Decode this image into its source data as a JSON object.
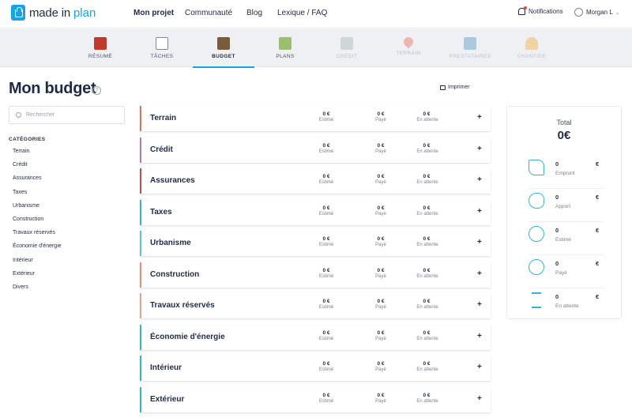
{
  "brand": {
    "part1": "made in",
    "part2": "plan"
  },
  "topnav": [
    {
      "label": "Mon projet",
      "active": true
    },
    {
      "label": "Communauté"
    },
    {
      "label": "Blog"
    },
    {
      "label": "Lexique / FAQ"
    }
  ],
  "header_right": {
    "notifications": "Notifications",
    "user": "Morgan L"
  },
  "tabs": [
    {
      "label": "RÉSUMÉ",
      "icon": "house-icon",
      "color": "#c0392b"
    },
    {
      "label": "TÂCHES",
      "icon": "checklist-icon",
      "color": "#7f8c8d"
    },
    {
      "label": "BUDGET",
      "icon": "calculator-icon",
      "color": "#7a5c3a",
      "active": true
    },
    {
      "label": "PLANS",
      "icon": "map-icon",
      "color": "#27ae60"
    },
    {
      "label": "CRÉDIT",
      "icon": "bank-icon",
      "color": "#7f8c8d",
      "disabled": true
    },
    {
      "label": "TERRAIN",
      "icon": "location-pin-icon",
      "color": "#e74c3c",
      "disabled": true
    },
    {
      "label": "PRESTATAIRES",
      "icon": "id-card-icon",
      "color": "#2980b9",
      "disabled": true
    },
    {
      "label": "CHANTIER",
      "icon": "hard-hat-icon",
      "color": "#f39c12",
      "disabled": true
    }
  ],
  "page_title": "Mon budget",
  "help_icon": "?",
  "print_label": "Imprimer",
  "search": {
    "placeholder": "Rechercher",
    "value": ""
  },
  "categories_title": "CATÉGORIES",
  "categories": [
    "Terrain",
    "Crédit",
    "Assurances",
    "Taxes",
    "Urbanisme",
    "Construction",
    "Travaux réservés",
    "Économie d'énergie",
    "Intérieur",
    "Extérieur",
    "Divers"
  ],
  "value_labels": {
    "estime": "Estimé",
    "paye": "Payé",
    "attente": "En attente"
  },
  "budget_rows": [
    {
      "name": "Terrain",
      "estime": "0 €",
      "paye": "0 €",
      "attente": "0 €",
      "color": "#c97b5a"
    },
    {
      "name": "Crédit",
      "estime": "0 €",
      "paye": "0 €",
      "attente": "0 €",
      "color": "#b07cc6"
    },
    {
      "name": "Assurances",
      "estime": "0 €",
      "paye": "0 €",
      "attente": "0 €",
      "color": "#c0504d"
    },
    {
      "name": "Taxes",
      "estime": "0 €",
      "paye": "0 €",
      "attente": "0 €",
      "color": "#3ab0d6"
    },
    {
      "name": "Urbanisme",
      "estime": "0 €",
      "paye": "0 €",
      "attente": "0 €",
      "color": "#5fc7c7"
    },
    {
      "name": "Construction",
      "estime": "0 €",
      "paye": "0 €",
      "attente": "0 €",
      "color": "#d9956b"
    },
    {
      "name": "Travaux réservés",
      "estime": "0 €",
      "paye": "0 €",
      "attente": "0 €",
      "color": "#e0a48a"
    },
    {
      "name": "Économie d'énergie",
      "estime": "0 €",
      "paye": "0 €",
      "attente": "0 €",
      "color": "#3ab0d6"
    },
    {
      "name": "Intérieur",
      "estime": "0 €",
      "paye": "0 €",
      "attente": "0 €",
      "color": "#3ab0d6"
    },
    {
      "name": "Extérieur",
      "estime": "0 €",
      "paye": "0 €",
      "attente": "0 €",
      "color": "#3ab0d6"
    }
  ],
  "row_add": "+",
  "total": {
    "label": "Total",
    "value": "0€"
  },
  "summary": [
    {
      "value": "0",
      "currency": "€",
      "label": "Emprunt",
      "icon": "hand-money-icon"
    },
    {
      "value": "0",
      "currency": "€",
      "label": "Apport",
      "icon": "piggy-bank-icon"
    },
    {
      "value": "0",
      "currency": "€",
      "label": "Estimé",
      "icon": "euro-coin-icon"
    },
    {
      "value": "0",
      "currency": "€",
      "label": "Payé",
      "icon": "check-circle-icon"
    },
    {
      "value": "0",
      "currency": "€",
      "label": "En attente",
      "icon": "hourglass-icon"
    }
  ]
}
